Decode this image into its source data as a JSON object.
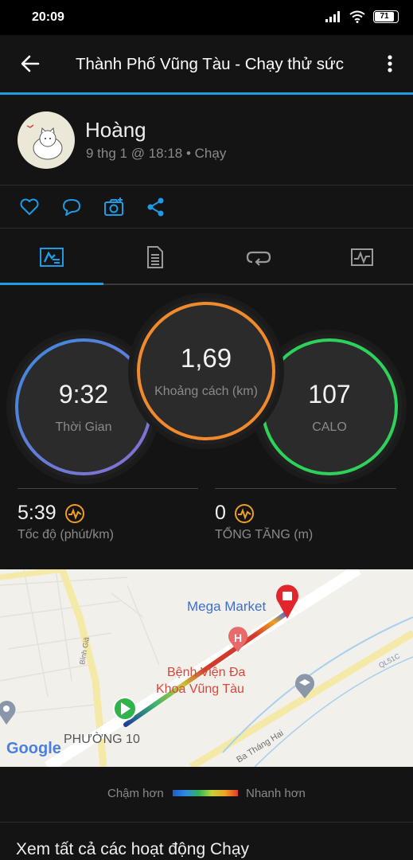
{
  "status_bar": {
    "time": "20:09",
    "battery": "71",
    "icons": [
      "signal-icon",
      "wifi-icon",
      "battery-icon"
    ]
  },
  "header": {
    "title": "Thành Phố Vũng Tàu - Chạy thử sức",
    "back_icon": "back-arrow-icon",
    "menu_icon": "more-vertical-icon"
  },
  "profile": {
    "name": "Hoàng",
    "meta": "9 thg 1 @ 18:18 • Chạy"
  },
  "actions": [
    "heart-icon",
    "comment-icon",
    "camera-icon",
    "share-icon"
  ],
  "tabs": [
    "summary-icon",
    "details-icon",
    "laps-icon",
    "charts-icon"
  ],
  "rings": {
    "time": {
      "value": "9:32",
      "label": "Thời Gian"
    },
    "distance": {
      "value": "1,69",
      "label": "Khoảng cách (km)"
    },
    "calories": {
      "value": "107",
      "label": "CALO"
    }
  },
  "sub_stats": {
    "pace": {
      "value": "5:39",
      "label": "Tốc độ (phút/km)"
    },
    "ascent": {
      "value": "0",
      "label": "TỔNG TĂNG (m)"
    }
  },
  "map": {
    "labels": {
      "mega_market": "Mega Market",
      "hospital_line1": "Bệnh Viện Đa",
      "hospital_line2": "Khoa Vũng Tàu",
      "ward": "PHƯỜNG 10",
      "street": "Ba Tháng Hai",
      "binh_gia": "Bình Giã",
      "road_code": "QL51C",
      "google": "Google"
    }
  },
  "legend": {
    "slower": "Chậm hơn",
    "faster": "Nhanh hơn"
  },
  "footer": {
    "see_all": "Xem tất cả các hoạt động Chạy"
  },
  "colors": {
    "accent": "#1f9be3",
    "ring_time": "#5b7ad6",
    "ring_distance": "#f08a2c",
    "ring_calories": "#2ed15a"
  }
}
